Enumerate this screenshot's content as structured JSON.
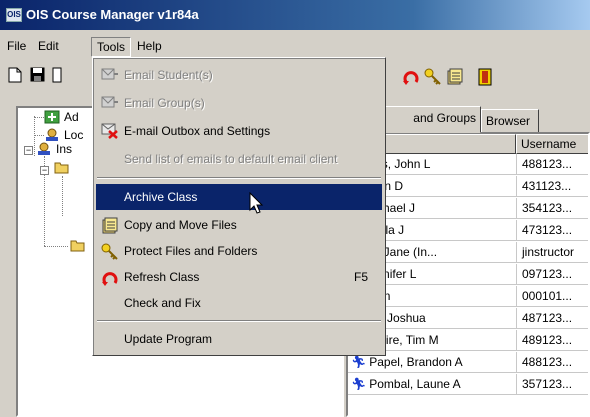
{
  "window": {
    "title": "OIS Course Manager v1r84a",
    "app_icon_text": "OIS"
  },
  "menubar": {
    "items": [
      "File",
      "Edit",
      "Tools",
      "Help"
    ],
    "open": "Tools"
  },
  "tools_menu": {
    "items": [
      {
        "label": "Email Student(s)",
        "icon": "email-icon",
        "enabled": false
      },
      {
        "label": "Email Group(s)",
        "icon": "email-icon",
        "enabled": false
      },
      {
        "label": "E-mail Outbox and Settings",
        "icon": "outbox-icon",
        "enabled": true
      },
      {
        "label": "Send list of emails to default email client",
        "icon": "",
        "enabled": false
      },
      {
        "label": "Archive Class",
        "icon": "",
        "enabled": true,
        "highlighted": true
      },
      {
        "label": "Copy and Move Files",
        "icon": "copy-files-icon",
        "enabled": true
      },
      {
        "label": "Protect Files and Folders",
        "icon": "key-icon",
        "enabled": true
      },
      {
        "label": "Refresh Class",
        "icon": "refresh-icon",
        "enabled": true,
        "shortcut": "F5"
      },
      {
        "label": "Check and Fix",
        "icon": "",
        "enabled": true
      },
      {
        "label": "Update Program",
        "icon": "",
        "enabled": true
      }
    ]
  },
  "tree": {
    "items": [
      {
        "label": "Ad",
        "icon": "add-user-icon"
      },
      {
        "label": "Loc",
        "icon": "user-icon"
      },
      {
        "label": "Ins",
        "icon": "user-icon"
      }
    ]
  },
  "tabs": {
    "groups_label": "and Groups",
    "browser_label": "Browser"
  },
  "list": {
    "headers": {
      "name": "ne",
      "username": "Username"
    },
    "rows": [
      {
        "name": "anders, John L",
        "username": "488123...",
        "show_icon": false
      },
      {
        "name": ", Kristin D",
        "username": "431123...",
        "show_icon": false
      },
      {
        "name": "e, Michael J",
        "username": "354123...",
        "show_icon": false
      },
      {
        "name": "n, Twyla J",
        "username": "473123...",
        "show_icon": false
      },
      {
        "name": "uctor, Jane  (In...",
        "username": "jinstructor",
        "show_icon": false
      },
      {
        "name": "s, Jennifer L",
        "username": "097123...",
        "show_icon": false
      },
      {
        "name": "h, John",
        "username": "000101...",
        "show_icon": false
      },
      {
        "name": "eghel, Joshua",
        "username": "487123...",
        "show_icon": false
      },
      {
        "name": "Moire, Tim M",
        "username": "489123...",
        "show_icon": true
      },
      {
        "name": "Papel, Brandon A",
        "username": "488123...",
        "show_icon": true
      },
      {
        "name": "Pombal, Laune A",
        "username": "357123...",
        "show_icon": true
      }
    ]
  },
  "colors": {
    "title_bar": "#0a246a",
    "highlight": "#0a246a",
    "face": "#d4d0c8"
  }
}
